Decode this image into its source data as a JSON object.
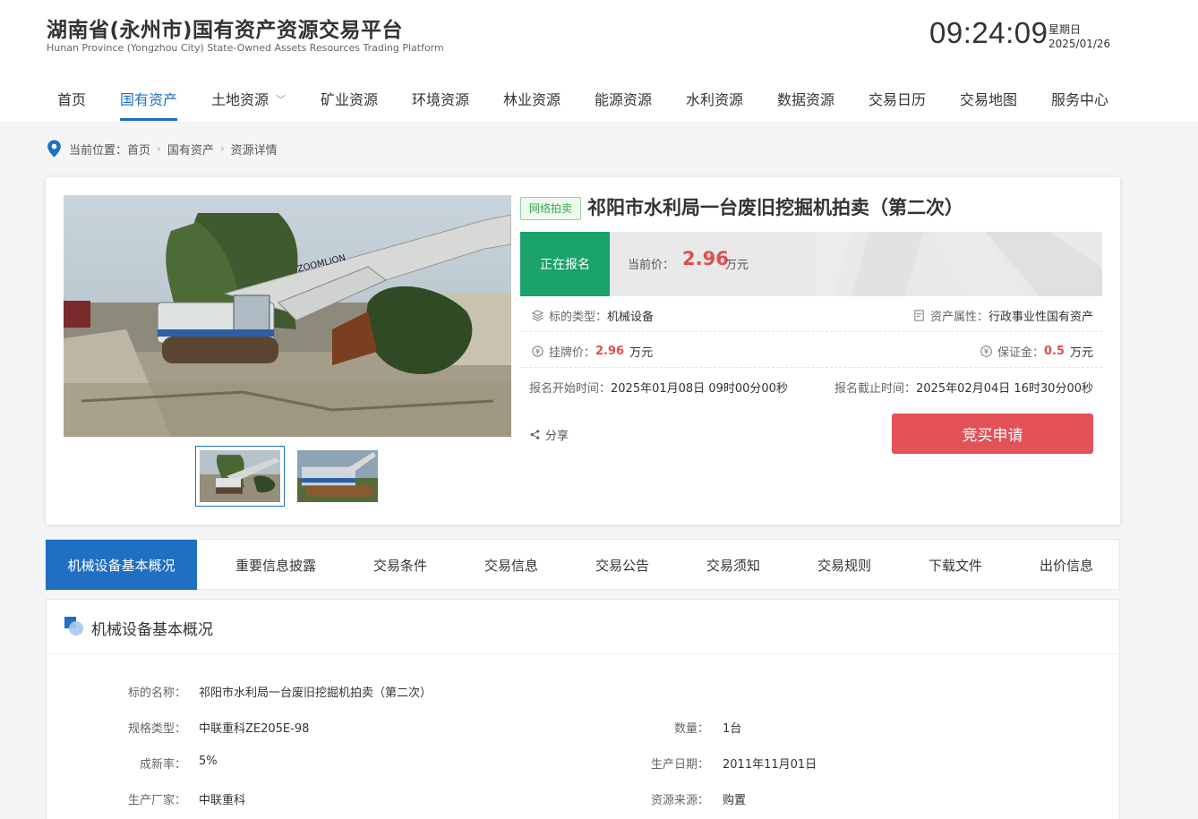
{
  "header": {
    "title": "湖南省(永州市)国有资产资源交易平台",
    "subtitle": "Hunan Province (Yongzhou City) State-Owned Assets Resources Trading Platform",
    "time": "09:24:09",
    "weekday": "星期日",
    "date": "2025/01/26"
  },
  "nav": {
    "items": [
      "首页",
      "国有资产",
      "土地资源",
      "矿业资源",
      "环境资源",
      "林业资源",
      "能源资源",
      "水利资源",
      "数据资源",
      "交易日历",
      "交易地图",
      "服务中心"
    ],
    "active": "国有资产"
  },
  "breadcrumb": {
    "prefix": "当前位置：",
    "items": [
      "首页",
      "国有资产",
      "资源详情"
    ]
  },
  "item": {
    "tag": "网络拍卖",
    "title": "祁阳市水利局一台废旧挖掘机拍卖（第二次）",
    "status": "正在报名",
    "price_label": "当前价：",
    "price": "2.96",
    "price_unit": "万元",
    "type_label": "标的类型：",
    "type_value": "机械设备",
    "attr_label": "资产属性：",
    "attr_value": "行政事业性国有资产",
    "list_price_label": "挂牌价：",
    "list_price": "2.96",
    "list_price_unit": "万元",
    "deposit_label": "保证金：",
    "deposit": "0.5",
    "deposit_unit": "万元",
    "start_label": "报名开始时间：",
    "start_value": "2025年01月08日 09时00分00秒",
    "end_label": "报名截止时间：",
    "end_value": "2025年02月04日 16时30分00秒",
    "share": "分享",
    "apply": "竞买申请",
    "photo_brand": "ZOOMLION"
  },
  "tabs": [
    "机械设备基本概况",
    "重要信息披露",
    "交易条件",
    "交易信息",
    "交易公告",
    "交易须知",
    "交易规则",
    "下载文件",
    "出价信息"
  ],
  "detail": {
    "heading": "机械设备基本概况",
    "name_label": "标的名称：",
    "name_value": "祁阳市水利局一台废旧挖掘机拍卖（第二次）",
    "spec_label": "规格类型：",
    "spec_value": "中联重科ZE205E-98",
    "qty_label": "数量：",
    "qty_value": "1台",
    "newness_label": "成新率：",
    "newness_value": "5%",
    "date_label": "生产日期：",
    "date_value": "2011年11月01日",
    "maker_label": "生产厂家：",
    "maker_value": "中联重科",
    "source_label": "资源来源：",
    "source_value": "购置"
  },
  "colors": {
    "primary": "#1f6fc2",
    "status_green": "#1aa36a",
    "price_red": "#e34c4c",
    "apply_red": "#e35256"
  }
}
